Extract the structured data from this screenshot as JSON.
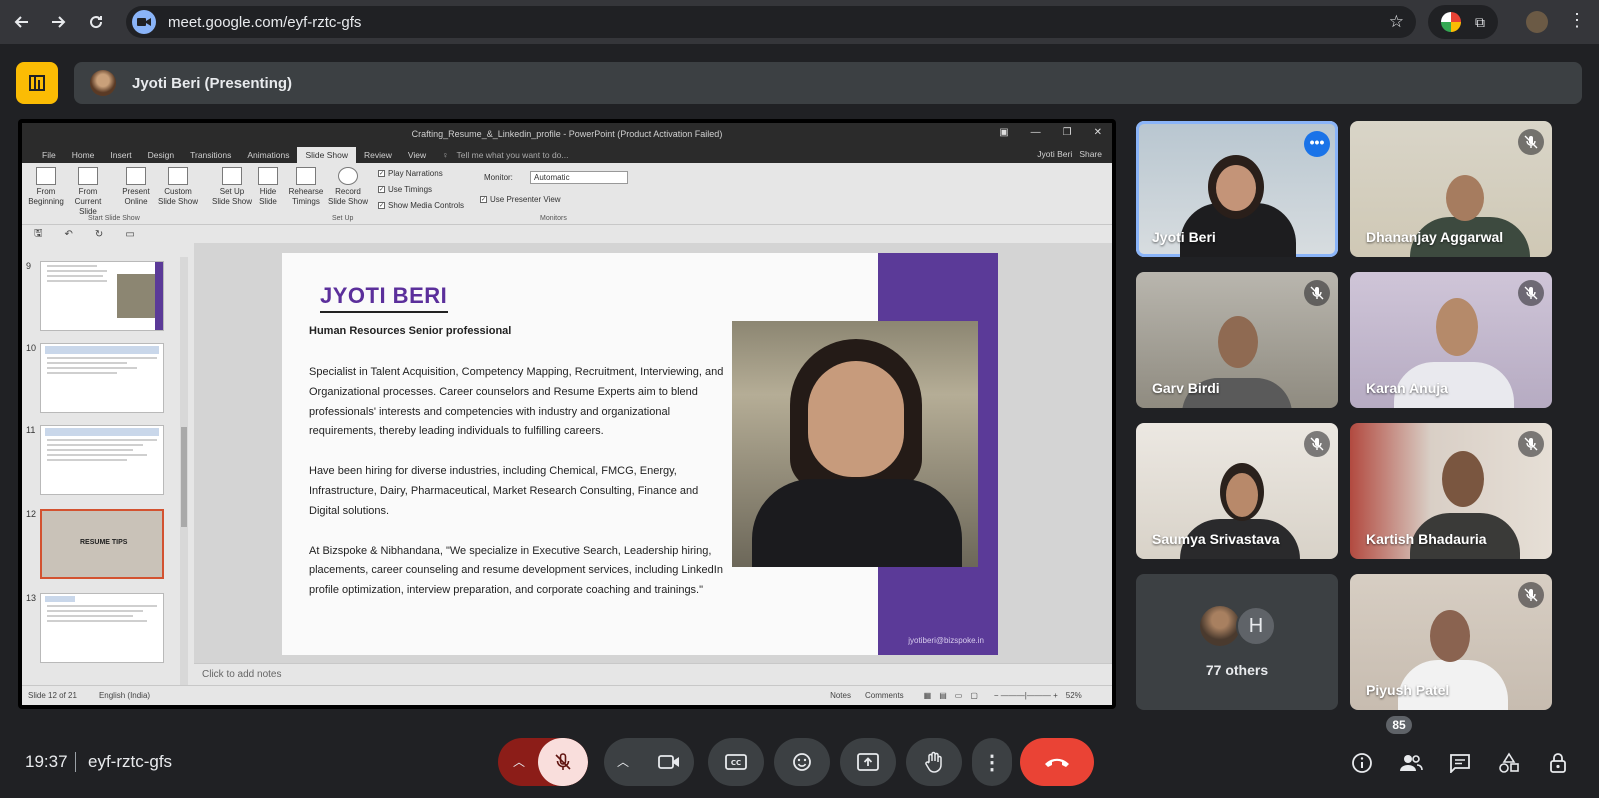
{
  "browser": {
    "url": "meet.google.com/eyf-rztc-gfs"
  },
  "presenter_bar": {
    "label": "Jyoti Beri (Presenting)"
  },
  "powerpoint": {
    "window_title": "Crafting_Resume_&_Linkedin_profile - PowerPoint (Product Activation Failed)",
    "tabs": [
      "File",
      "Home",
      "Insert",
      "Design",
      "Transitions",
      "Animations",
      "Slide Show",
      "Review",
      "View"
    ],
    "tell_me": "Tell me what you want to do...",
    "user": "Jyoti Beri",
    "share": "Share",
    "ribbon": {
      "from_beginning": "From Beginning",
      "from_current": "From Current Slide",
      "present_online": "Present Online",
      "custom_show": "Custom Slide Show",
      "group_start": "Start Slide Show",
      "setup_show": "Set Up Slide Show",
      "hide_slide": "Hide Slide",
      "rehearse": "Rehearse Timings",
      "record": "Record Slide Show",
      "play_narrations": "Play Narrations",
      "use_timings": "Use Timings",
      "show_media": "Show Media Controls",
      "group_setup": "Set Up",
      "monitor_label": "Monitor:",
      "monitor_value": "Automatic",
      "presenter_view": "Use Presenter View",
      "group_monitors": "Monitors"
    },
    "thumbs": [
      {
        "num": "9"
      },
      {
        "num": "10"
      },
      {
        "num": "11"
      },
      {
        "num": "12",
        "label": "RESUME TIPS"
      },
      {
        "num": "13"
      }
    ],
    "slide": {
      "name": "JYOTI BERI",
      "subtitle": "Human Resources Senior professional",
      "p1": "Specialist in Talent Acquisition, Competency Mapping, Recruitment, Interviewing, and Organizational processes. Career counselors and Resume Experts aim to blend professionals' interests and competencies with industry and organizational requirements, thereby leading individuals to fulfilling careers.",
      "p2": "Have been hiring for diverse industries, including Chemical, FMCG, Energy, Infrastructure, Dairy, Pharmaceutical, Market Research Consulting, Finance and Digital solutions.",
      "p3": "At Bizspoke & Nibhandana, \"We specialize in Executive Search, Leadership hiring, placements, career counseling and resume development services, including LinkedIn profile optimization, interview preparation, and corporate coaching and trainings.\"",
      "email": "jyotiberi@bizspoke.in"
    },
    "notes_placeholder": "Click to add notes",
    "status": {
      "slide_of": "Slide 12 of 21",
      "language": "English (India)",
      "notes": "Notes",
      "comments": "Comments",
      "zoom": "52%"
    }
  },
  "participants": [
    {
      "name": "Jyoti Beri",
      "speaking": true
    },
    {
      "name": "Dhananjay Aggarwal",
      "muted": true
    },
    {
      "name": "Garv Birdi",
      "muted": true
    },
    {
      "name": "Karan Anuja",
      "muted": true
    },
    {
      "name": "Saumya Srivastava",
      "muted": true
    },
    {
      "name": "Kartish Bhadauria",
      "muted": true
    },
    {
      "name": "Piyush Patel",
      "muted": true
    }
  ],
  "others": {
    "initial": "H",
    "label": "77 others"
  },
  "bottom": {
    "time": "19:37",
    "meeting_code": "eyf-rztc-gfs",
    "people_count": "85"
  },
  "colors": {
    "meet_bg": "#202124",
    "end_call": "#ea4335",
    "logo": "#fbbc04",
    "slide_accent": "#5b3a98"
  }
}
